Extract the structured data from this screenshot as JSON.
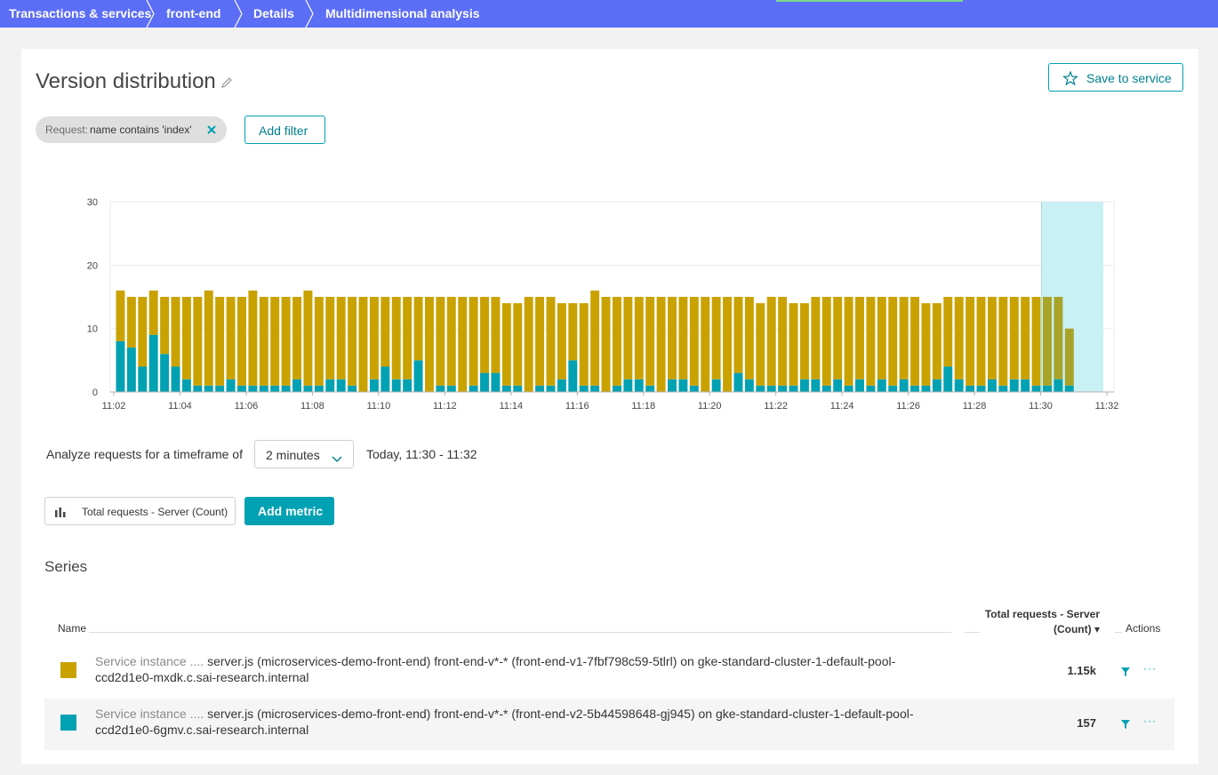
{
  "breadcrumb": [
    "Transactions & services",
    "front-end",
    "Details",
    "Multidimensional analysis"
  ],
  "page": {
    "title": "Version distribution",
    "save_label": "Save to service"
  },
  "filter": {
    "key": "Request:",
    "value": "name contains 'index'"
  },
  "add_filter_label": "Add filter",
  "timeframe": {
    "label": "Analyze requests for a timeframe of",
    "selected": "2 minutes",
    "range": "Today, 11:30 - 11:32"
  },
  "metric": {
    "label": "Total requests - Server (Count)",
    "add_label": "Add metric"
  },
  "series_heading": "Series",
  "table": {
    "col_name": "Name",
    "col_metric_line1": "Total requests - Server",
    "col_metric_line2": "(Count) ▾",
    "col_actions": "Actions",
    "rows": [
      {
        "prefix": "Service instance ....",
        "text": "server.js (microservices-demo-front-end) front-end-v*-* (front-end-v1-7fbf798c59-5tlrl) on gke-standard-cluster-1-default-pool-ccd2d1e0-mxdk.c.sai-research.internal",
        "value": "1.15k",
        "color": "#c9a200"
      },
      {
        "prefix": "Service instance ....",
        "text": "server.js (microservices-demo-front-end) front-end-v*-* (front-end-v2-5b44598648-gj945) on gke-standard-cluster-1-default-pool-ccd2d1e0-6gmv.c.sai-research.internal",
        "value": "157",
        "color": "#00a1b2"
      }
    ]
  },
  "colors": {
    "accent": "#00a1b2",
    "v1": "#c9a200",
    "v2": "#00a1b2",
    "nav": "#5b6ef5",
    "highlight": "#c9f0f5"
  },
  "chart_data": {
    "type": "bar",
    "stacked": true,
    "ylim": [
      0,
      30
    ],
    "yticks": [
      0,
      10,
      20,
      30
    ],
    "xtick_labels": [
      "11:02",
      "11:04",
      "11:06",
      "11:08",
      "11:10",
      "11:12",
      "11:14",
      "11:16",
      "11:18",
      "11:20",
      "11:22",
      "11:24",
      "11:26",
      "11:28",
      "11:30",
      "11:32"
    ],
    "x_start": "11:02",
    "x_end": "11:32",
    "selected_range": [
      "11:30",
      "11:32"
    ],
    "series": [
      {
        "name": "v2",
        "color": "#00a1b2",
        "values": [
          8,
          7,
          4,
          9,
          6,
          4,
          2,
          1,
          1,
          1,
          2,
          1,
          1,
          1,
          1,
          1,
          2,
          1,
          1,
          2,
          2,
          1,
          0,
          2,
          4,
          2,
          2,
          5,
          0,
          1,
          1,
          0,
          1,
          3,
          3,
          1,
          1,
          0,
          1,
          1,
          2,
          5,
          1,
          1,
          0,
          1,
          2,
          2,
          1,
          0,
          2,
          2,
          1,
          0,
          2,
          0,
          3,
          2,
          1,
          1,
          1,
          1,
          2,
          2,
          1,
          2,
          1,
          2,
          1,
          2,
          1,
          2,
          1,
          1,
          2,
          4,
          2,
          1,
          1,
          2,
          1,
          2,
          2,
          1,
          1,
          2,
          1
        ]
      },
      {
        "name": "v1",
        "color": "#c9a200",
        "values": [
          8,
          8,
          11,
          7,
          9,
          11,
          13,
          14,
          15,
          14,
          13,
          14,
          15,
          14,
          14,
          14,
          13,
          15,
          14,
          13,
          13,
          14,
          15,
          13,
          11,
          13,
          13,
          10,
          15,
          14,
          14,
          15,
          14,
          12,
          12,
          13,
          13,
          15,
          14,
          14,
          12,
          9,
          13,
          15,
          15,
          14,
          13,
          13,
          14,
          15,
          13,
          13,
          14,
          15,
          13,
          15,
          12,
          13,
          13,
          14,
          14,
          13,
          12,
          13,
          14,
          13,
          14,
          13,
          14,
          13,
          14,
          13,
          14,
          13,
          12,
          11,
          13,
          14,
          14,
          13,
          14,
          13,
          13,
          14,
          14,
          13,
          9
        ]
      }
    ]
  }
}
